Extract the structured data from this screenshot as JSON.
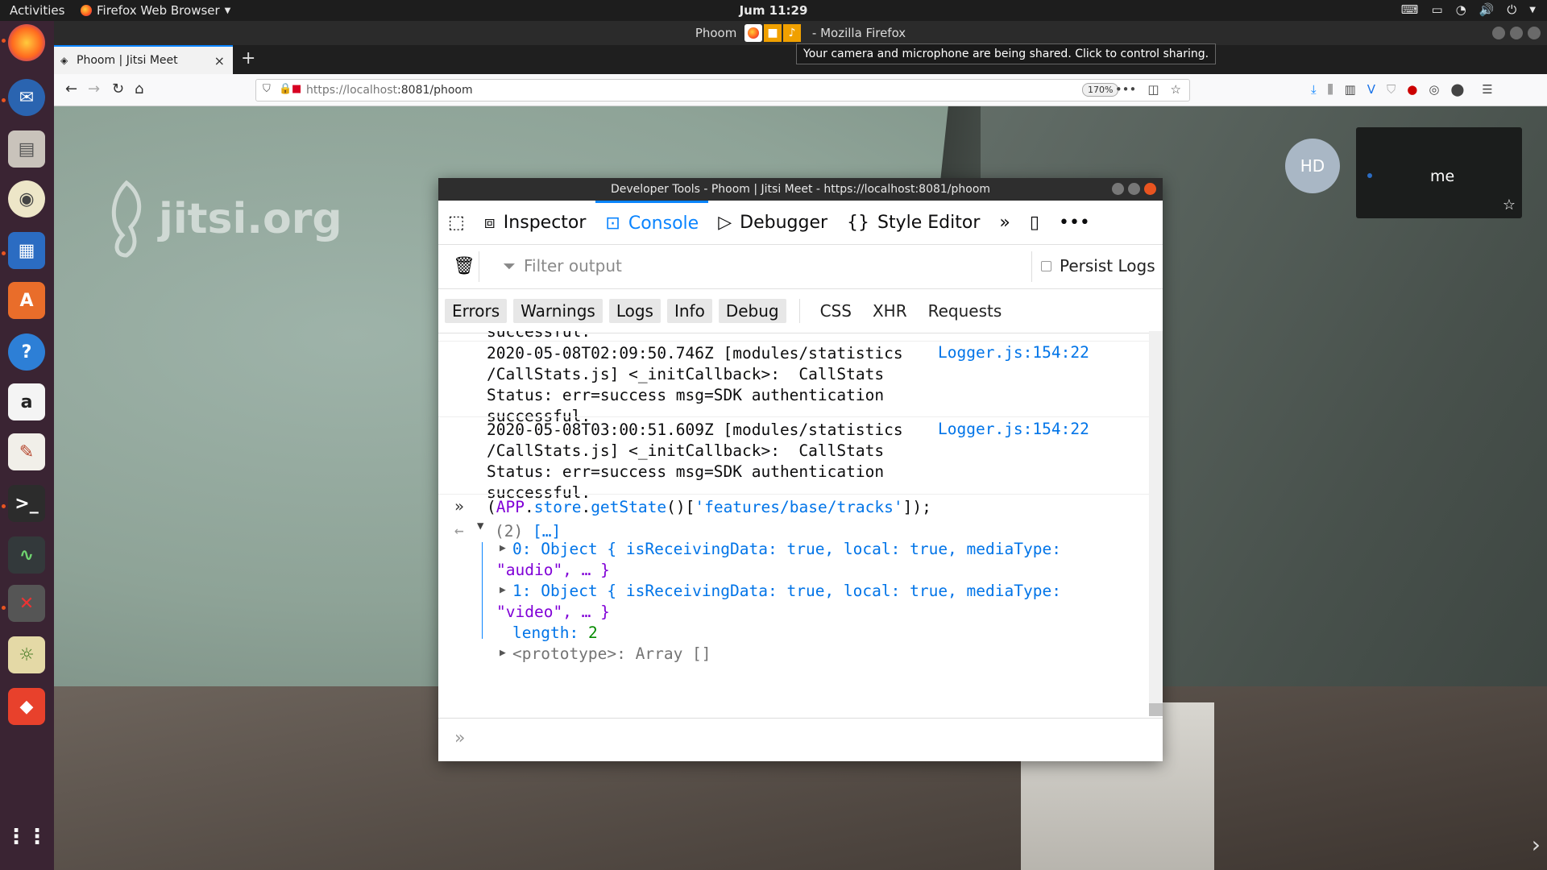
{
  "topbar": {
    "activities": "Activities",
    "app_menu": "Firefox Web Browser",
    "clock": "Jum 11:29"
  },
  "window": {
    "title": "Phoom | Jitsi Meet - Mozilla Firefox",
    "title_visible_left": "Phoom",
    "title_visible_right": "- Mozilla Firefox"
  },
  "tooltip": "Your camera and microphone are being shared. Click to control sharing.",
  "tab": {
    "title": "Phoom | Jitsi Meet",
    "close": "×",
    "new_tab": "+"
  },
  "nav": {
    "url_host": "https://localhost",
    "url_rest": ":8081/phoom",
    "zoom": "170%",
    "page_actions": "•••"
  },
  "page": {
    "logo_text": "jitsi.org",
    "avatar_initials": "HD",
    "self_label": "me"
  },
  "devtools": {
    "title": "Developer Tools - Phoom | Jitsi Meet - https://localhost:8081/phoom",
    "tabs": [
      "Inspector",
      "Console",
      "Debugger",
      "Style Editor"
    ],
    "active_tab": "Console",
    "filter_placeholder": "Filter output",
    "persist_logs": "Persist Logs",
    "levels": [
      "Errors",
      "Warnings",
      "Logs",
      "Info",
      "Debug"
    ],
    "types": [
      "CSS",
      "XHR",
      "Requests"
    ],
    "log_cut_above": "successful.",
    "messages": [
      {
        "text": "2020-05-08T02:09:50.746Z [modules/statistics\n/CallStats.js] <_initCallback>:  CallStats\nStatus: err=success msg=SDK authentication\nsuccessful.",
        "source": "Logger.js:154:22"
      },
      {
        "text": "2020-05-08T03:00:51.609Z [modules/statistics\n/CallStats.js] <_initCallback>:  CallStats\nStatus: err=success msg=SDK authentication\nsuccessful.",
        "source": "Logger.js:154:22"
      }
    ],
    "command": {
      "open_paren": "(",
      "app": "APP",
      "dot1": ".",
      "store": "store",
      "dot2": ".",
      "getState": "getState",
      "call": "()[",
      "arg": "'features/base/tracks'",
      "close": "]);"
    },
    "result": {
      "header_count": "(2)",
      "header_preview": "[…]",
      "item0_idx": "0:",
      "item0_line1": "Object { isReceivingData: true, local: true, mediaType:",
      "item0_line2": "\"audio\", … }",
      "item1_idx": "1:",
      "item1_line1": "Object { isReceivingData: true, local: true, mediaType:",
      "item1_line2": "\"video\", … }",
      "length_key": "length:",
      "length_val": "2",
      "proto": "<prototype>: Array []"
    }
  },
  "colors": {
    "accent": "#0a84ff",
    "dock_bg": "#3a2433",
    "ubuntu_orange": "#e95420"
  }
}
